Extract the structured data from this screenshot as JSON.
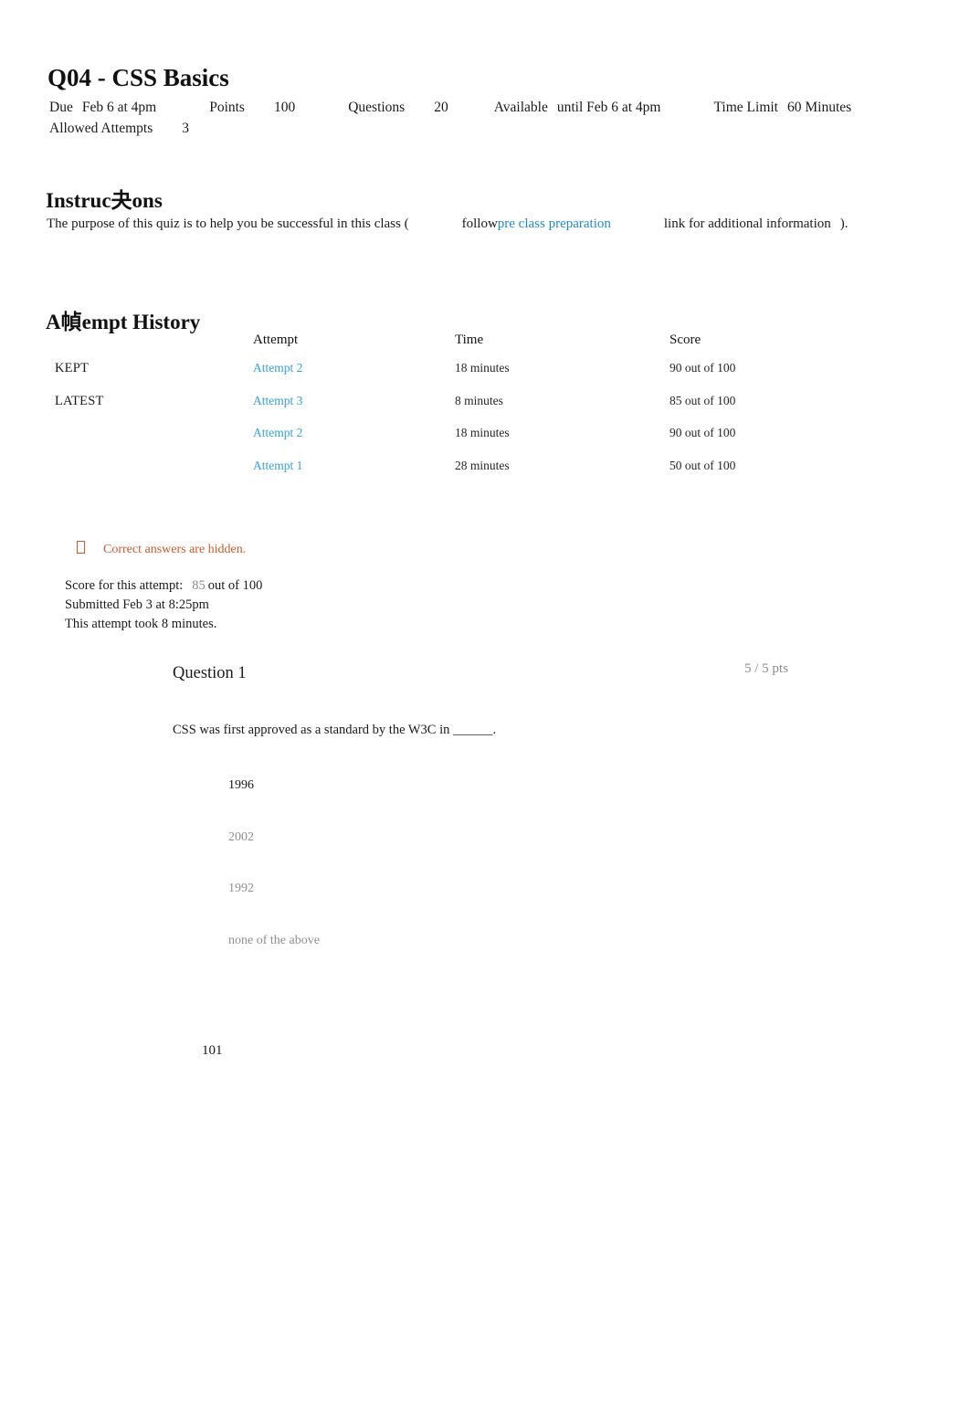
{
  "quiz": {
    "title": "Q04 - CSS Basics"
  },
  "meta": {
    "due_label": "Due",
    "due_value": "Feb 6 at 4pm",
    "points_label": "Points",
    "points_value": "100",
    "questions_label": "Questions",
    "questions_value": "20",
    "available_label": "Available",
    "available_value": "until Feb 6 at 4pm",
    "time_limit_label": "Time Limit",
    "time_limit_value": "60 Minutes",
    "allowed_attempts_label": "Allowed Attempts",
    "allowed_attempts_value": "3"
  },
  "instructions": {
    "heading": "Instruc夬ons",
    "text_before": "The purpose of this quiz is to help you be successful in this class (",
    "follow_word": "follow",
    "link_text": "pre class preparation",
    "text_after": "link for additional information",
    "text_close": ")."
  },
  "attempt_history": {
    "heading": "A幀empt History",
    "columns": {
      "status": "",
      "attempt": "Attempt",
      "time": "Time",
      "score": "Score"
    },
    "rows": [
      {
        "status": "KEPT",
        "attempt": "Attempt 2",
        "time": "18 minutes",
        "score": "90 out of 100"
      },
      {
        "status": "LATEST",
        "attempt": "Attempt 3",
        "time": "8 minutes",
        "score": "85 out of 100"
      },
      {
        "status": "",
        "attempt": "Attempt 2",
        "time": "18 minutes",
        "score": "90 out of 100"
      },
      {
        "status": "",
        "attempt": "Attempt 1",
        "time": "28 minutes",
        "score": "50 out of 100"
      }
    ]
  },
  "notice": {
    "icon": "missing-glyph-box",
    "text": "Correct answers are hidden."
  },
  "score_summary": {
    "score_label": "Score for this attempt:",
    "score_value": "85",
    "score_suffix": "out of 100",
    "submitted": "Submitted Feb 3 at 8:25pm",
    "duration": "This attempt took 8 minutes."
  },
  "question": {
    "name": "Question 1",
    "points": "5 / 5 pts",
    "text": "CSS was first approved as a standard by the W3C in ______.",
    "answers": [
      {
        "label": "1996",
        "selected": true
      },
      {
        "label": "2002",
        "selected": false
      },
      {
        "label": "1992",
        "selected": false
      },
      {
        "label": "none of the above",
        "selected": false
      }
    ]
  },
  "footer": {
    "page_number": "101"
  },
  "colors": {
    "link": "#1f8ad2",
    "attempt_link": "#30a2e3",
    "notice": "#d05a2b",
    "muted": "#8e8e8e",
    "text": "#1a1a1a"
  }
}
